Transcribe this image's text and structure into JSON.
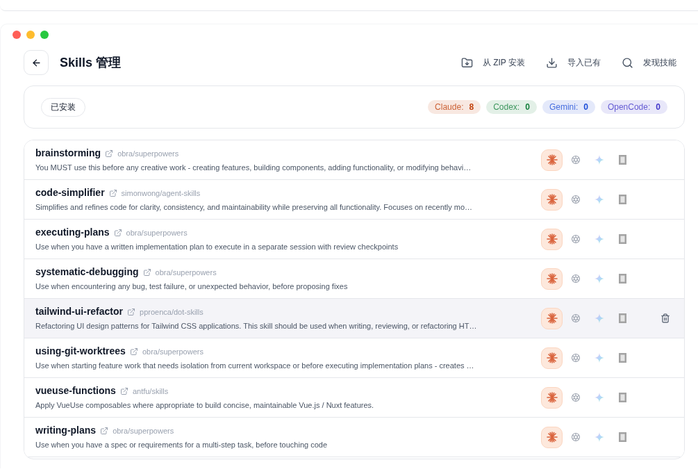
{
  "header": {
    "title": "Skills 管理",
    "actions": [
      {
        "kind": "zip",
        "label": "从 ZIP 安装"
      },
      {
        "kind": "import",
        "label": "导入已有"
      },
      {
        "kind": "discover",
        "label": "发现技能"
      }
    ]
  },
  "filter": {
    "tab": "已安装",
    "counts": [
      {
        "label": "Claude:",
        "value": "8",
        "color": "#c2410c"
      },
      {
        "label": "Codex:",
        "value": "0",
        "color": "#15803d"
      },
      {
        "label": "Gemini:",
        "value": "0",
        "color": "#1d4ed8"
      },
      {
        "label": "OpenCode:",
        "value": "0",
        "color": "#4338ca"
      }
    ]
  },
  "skills": [
    {
      "name": "brainstorming",
      "source": "obra/superpowers",
      "description": "You MUST use this before any creative work - creating features, building components, adding functionality, or modifying behavi…",
      "hovered": false,
      "tools": [
        {
          "kind": "claude",
          "on": true
        },
        {
          "kind": "codex",
          "on": false
        },
        {
          "kind": "gemini",
          "on": false
        },
        {
          "kind": "opencode",
          "on": false
        }
      ]
    },
    {
      "name": "code-simplifier",
      "source": "simonwong/agent-skills",
      "description": "Simplifies and refines code for clarity, consistency, and maintainability while preserving all functionality. Focuses on recently mo…",
      "hovered": false,
      "tools": [
        {
          "kind": "claude",
          "on": true
        },
        {
          "kind": "codex",
          "on": false
        },
        {
          "kind": "gemini",
          "on": false
        },
        {
          "kind": "opencode",
          "on": false
        }
      ]
    },
    {
      "name": "executing-plans",
      "source": "obra/superpowers",
      "description": "Use when you have a written implementation plan to execute in a separate session with review checkpoints",
      "hovered": false,
      "tools": [
        {
          "kind": "claude",
          "on": true
        },
        {
          "kind": "codex",
          "on": false
        },
        {
          "kind": "gemini",
          "on": false
        },
        {
          "kind": "opencode",
          "on": false
        }
      ]
    },
    {
      "name": "systematic-debugging",
      "source": "obra/superpowers",
      "description": "Use when encountering any bug, test failure, or unexpected behavior, before proposing fixes",
      "hovered": false,
      "tools": [
        {
          "kind": "claude",
          "on": true
        },
        {
          "kind": "codex",
          "on": false
        },
        {
          "kind": "gemini",
          "on": false
        },
        {
          "kind": "opencode",
          "on": false
        }
      ]
    },
    {
      "name": "tailwind-ui-refactor",
      "source": "pproenca/dot-skills",
      "description": "Refactoring UI design patterns for Tailwind CSS applications. This skill should be used when writing, reviewing, or refactoring HT…",
      "hovered": true,
      "tools": [
        {
          "kind": "claude",
          "on": true
        },
        {
          "kind": "codex",
          "on": false
        },
        {
          "kind": "gemini",
          "on": false
        },
        {
          "kind": "opencode",
          "on": false
        }
      ]
    },
    {
      "name": "using-git-worktrees",
      "source": "obra/superpowers",
      "description": "Use when starting feature work that needs isolation from current workspace or before executing implementation plans - creates …",
      "hovered": false,
      "tools": [
        {
          "kind": "claude",
          "on": true
        },
        {
          "kind": "codex",
          "on": false
        },
        {
          "kind": "gemini",
          "on": false
        },
        {
          "kind": "opencode",
          "on": false
        }
      ]
    },
    {
      "name": "vueuse-functions",
      "source": "antfu/skills",
      "description": "Apply VueUse composables where appropriate to build concise, maintainable Vue.js / Nuxt features.",
      "hovered": false,
      "tools": [
        {
          "kind": "claude",
          "on": true
        },
        {
          "kind": "codex",
          "on": false
        },
        {
          "kind": "gemini",
          "on": false
        },
        {
          "kind": "opencode",
          "on": false
        }
      ]
    },
    {
      "name": "writing-plans",
      "source": "obra/superpowers",
      "description": "Use when you have a spec or requirements for a multi-step task, before touching code",
      "hovered": false,
      "tools": [
        {
          "kind": "claude",
          "on": true
        },
        {
          "kind": "codex",
          "on": false
        },
        {
          "kind": "gemini",
          "on": false
        },
        {
          "kind": "opencode",
          "on": false
        }
      ]
    }
  ]
}
